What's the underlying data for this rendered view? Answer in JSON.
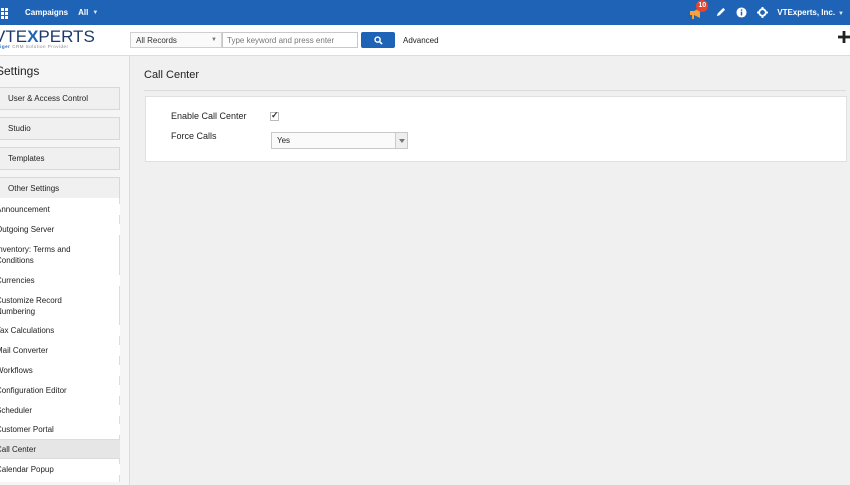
{
  "topnav": {
    "module": "Campaigns",
    "filter": "All",
    "notification_count": "10",
    "company": "VTExperts, Inc."
  },
  "header": {
    "logo_text_a": "VTE",
    "logo_text_x": "X",
    "logo_text_b": "PERTS",
    "logo_tag_a": "vTiger",
    "logo_tag_b": "CRM Solution Provider",
    "records_select": "All Records",
    "search_placeholder": "Type keyword and press enter",
    "advanced": "Advanced"
  },
  "sidebar": {
    "title": "Settings",
    "sections": [
      "User & Access Control",
      "Studio",
      "Templates",
      "Other Settings"
    ],
    "items": [
      "Announcement",
      "Outgoing Server",
      "Inventory: Terms and Conditions",
      "Currencies",
      "Customize Record Numbering",
      "Tax Calculations",
      "Mail Converter",
      "Workflows",
      "Configuration Editor",
      "Scheduler",
      "Customer Portal",
      "Call Center",
      "Calendar Popup"
    ],
    "selected": "Call Center"
  },
  "main": {
    "title": "Call Center",
    "enable_label": "Enable Call Center",
    "enable_checked": true,
    "force_label": "Force Calls",
    "force_value": "Yes"
  },
  "colors": {
    "brand": "#1e63b6",
    "badge": "#e8432e"
  }
}
